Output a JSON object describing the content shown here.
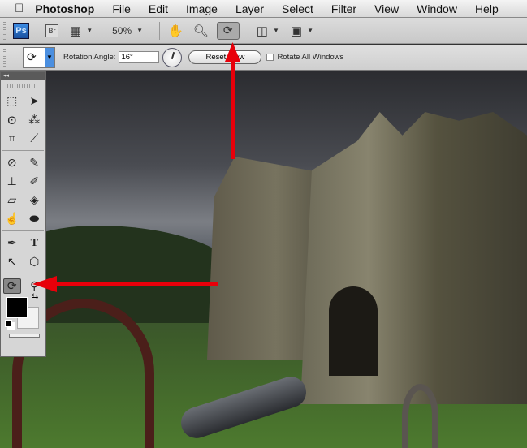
{
  "menubar": {
    "apple": "",
    "app": "Photoshop",
    "items": [
      "File",
      "Edit",
      "Image",
      "Layer",
      "Select",
      "Filter",
      "View",
      "Window",
      "Help"
    ]
  },
  "appbar": {
    "ps": "Ps",
    "br": "Br",
    "zoom": "50%"
  },
  "options": {
    "rotation_label": "Rotation Angle:",
    "rotation_value": "16°",
    "reset_label": "Reset View",
    "rotate_all_label": "Rotate All Windows",
    "rotate_all_checked": false
  },
  "tools": {
    "collapse": "◂◂"
  },
  "colors": {
    "foreground": "#000000",
    "background": "#f2f2f2",
    "annotation_arrow": "#e8000a"
  }
}
